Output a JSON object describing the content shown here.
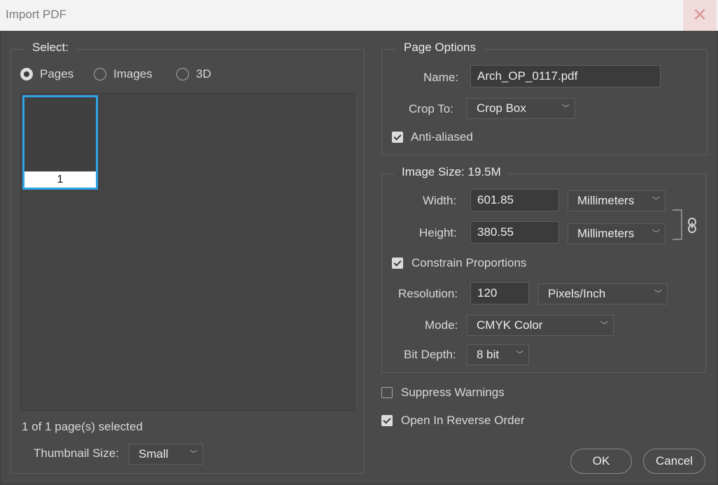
{
  "window": {
    "title": "Import PDF",
    "close_glyph": "✕"
  },
  "select_group": {
    "legend": "Select:",
    "options": [
      {
        "label": "Pages",
        "selected": true
      },
      {
        "label": "Images",
        "selected": false
      },
      {
        "label": "3D",
        "selected": false
      }
    ],
    "thumbnails": [
      {
        "page_number": "1",
        "selected": true
      }
    ],
    "status": "1 of 1 page(s) selected",
    "thumbnail_size_label": "Thumbnail Size:",
    "thumbnail_size_value": "Small"
  },
  "page_options": {
    "legend": "Page Options",
    "name_label": "Name:",
    "name_value": "Arch_OP_0117.pdf",
    "crop_label": "Crop To:",
    "crop_value": "Crop Box",
    "anti_aliased_label": "Anti-aliased",
    "anti_aliased": true
  },
  "image_size": {
    "legend": "Image Size: 19.5M",
    "width_label": "Width:",
    "width_value": "601.85",
    "width_unit": "Millimeters",
    "height_label": "Height:",
    "height_value": "380.55",
    "height_unit": "Millimeters",
    "link_icon": "chain-link-icon",
    "constrain_label": "Constrain Proportions",
    "constrain": true,
    "resolution_label": "Resolution:",
    "resolution_value": "120",
    "resolution_unit": "Pixels/Inch",
    "mode_label": "Mode:",
    "mode_value": "CMYK Color",
    "bit_depth_label": "Bit Depth:",
    "bit_depth_value": "8 bit"
  },
  "options": {
    "suppress_label": "Suppress Warnings",
    "suppress": false,
    "reverse_label": "Open In Reverse Order",
    "reverse": true
  },
  "buttons": {
    "ok": "OK",
    "cancel": "Cancel"
  },
  "colors": {
    "background": "#4a4a4a",
    "selection": "#2ea3e6",
    "titlebar": "#f3f3f3"
  }
}
